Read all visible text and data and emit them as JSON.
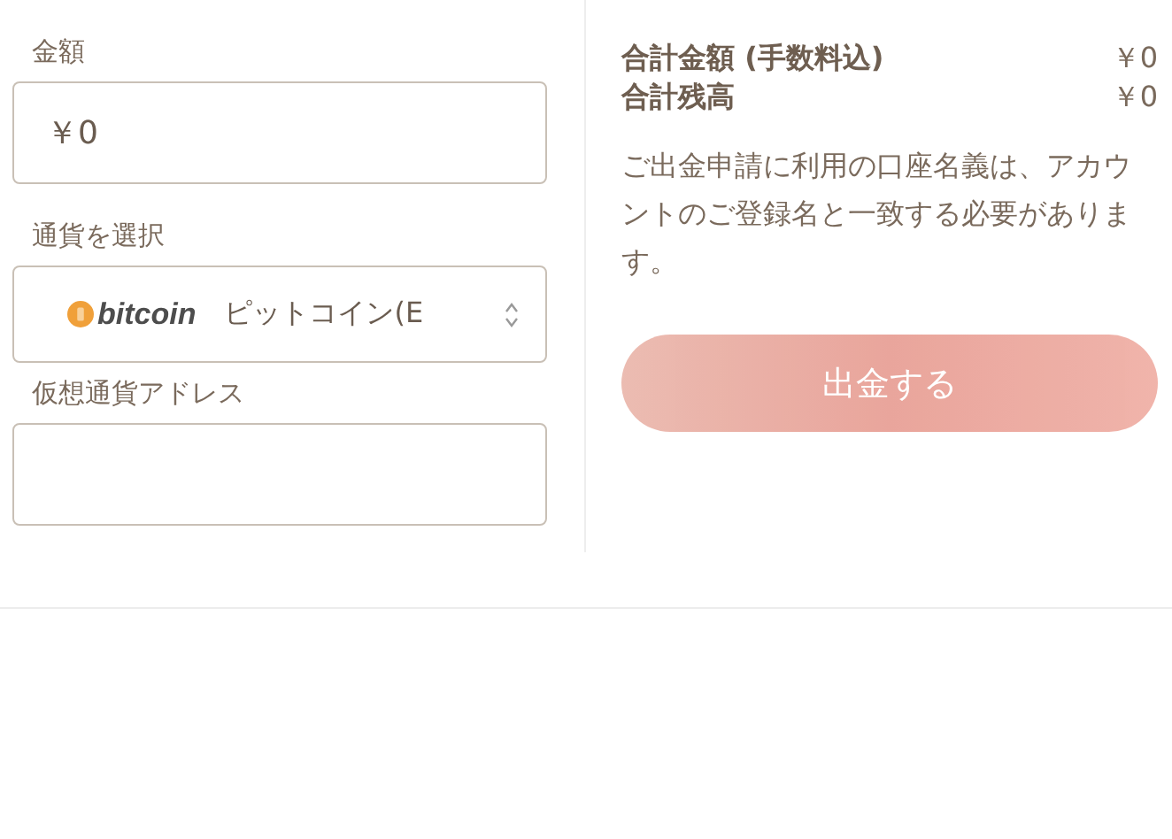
{
  "amount": {
    "label": "金額",
    "value": "￥0"
  },
  "currency": {
    "label": "通貨を選択",
    "logo_text": "bitcoin",
    "value": "ピットコイン(E"
  },
  "address": {
    "label": "仮想通貨アドレス"
  },
  "summary": [
    {
      "label": "合計金額 (手数料込)",
      "value": "￥0"
    },
    {
      "label": "合計残高",
      "value": "￥0"
    }
  ],
  "notice": "ご出金申請に利用の口座名義は、アカウントのご登録名と一致する必要があります。",
  "submit": {
    "label": "出金する",
    "disabled": true
  }
}
